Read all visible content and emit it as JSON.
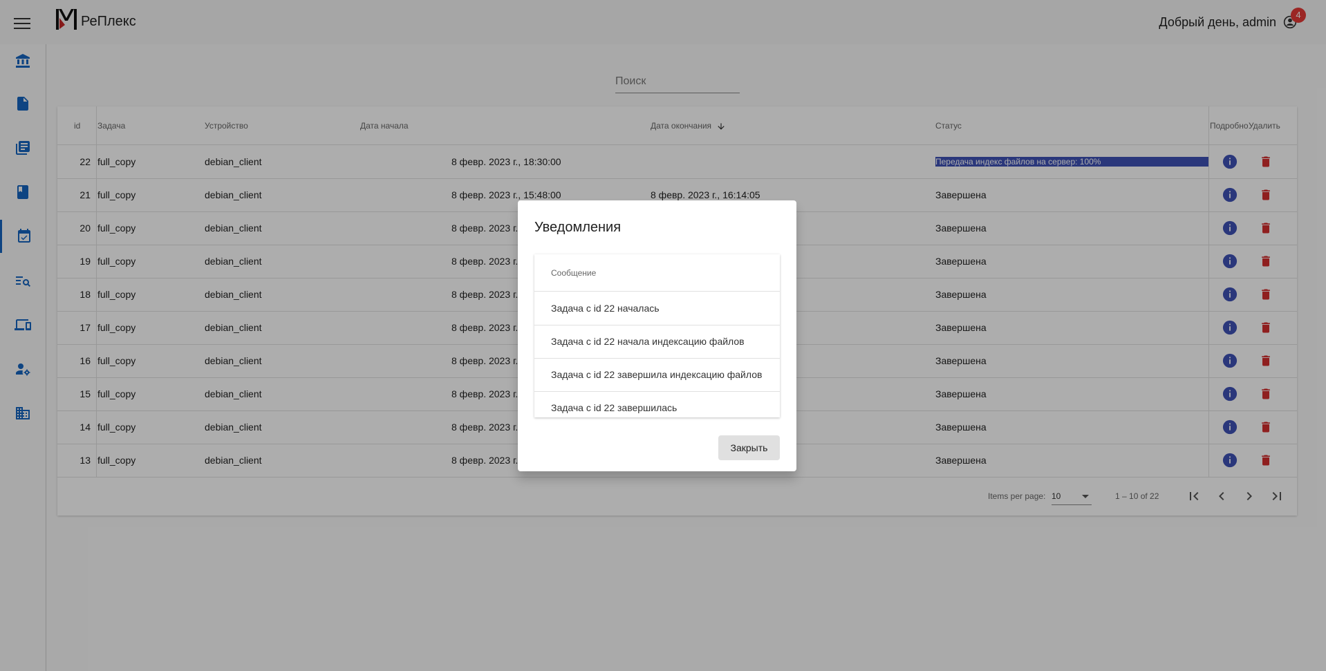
{
  "app": {
    "title": "РеПлекс",
    "greeting": "Добрый день, admin",
    "notification_count": "4"
  },
  "sidebar": {
    "items": [
      {
        "icon": "bank-icon"
      },
      {
        "icon": "document-icon"
      },
      {
        "icon": "library-icon"
      },
      {
        "icon": "book-icon"
      },
      {
        "icon": "calendar-check-icon",
        "active": true
      },
      {
        "icon": "search-list-icon"
      },
      {
        "icon": "devices-icon"
      },
      {
        "icon": "user-settings-icon"
      },
      {
        "icon": "building-icon"
      }
    ]
  },
  "search": {
    "placeholder": "Поиск"
  },
  "table": {
    "headers": {
      "id": "id",
      "task": "Задача",
      "device": "Устройство",
      "start": "Дата начала",
      "end": "Дата окончания",
      "status": "Статус",
      "details": "Подробно",
      "delete": "Удалить"
    },
    "rows": [
      {
        "id": "22",
        "task": "full_copy",
        "device": "debian_client",
        "start": "8 февр. 2023 г., 18:30:00",
        "end": "",
        "status": "Передача индекс файлов на сервер: 100%"
      },
      {
        "id": "21",
        "task": "full_copy",
        "device": "debian_client",
        "start": "8 февр. 2023 г., 15:48:00",
        "end": "8 февр. 2023 г., 16:14:05",
        "status": "Завершена"
      },
      {
        "id": "20",
        "task": "full_copy",
        "device": "debian_client",
        "start": "8 февр. 2023 г.",
        "end": "",
        "status": "Завершена"
      },
      {
        "id": "19",
        "task": "full_copy",
        "device": "debian_client",
        "start": "8 февр. 2023 г.",
        "end": "",
        "status": "Завершена"
      },
      {
        "id": "18",
        "task": "full_copy",
        "device": "debian_client",
        "start": "8 февр. 2023 г.",
        "end": "",
        "status": "Завершена"
      },
      {
        "id": "17",
        "task": "full_copy",
        "device": "debian_client",
        "start": "8 февр. 2023 г.",
        "end": "",
        "status": "Завершена"
      },
      {
        "id": "16",
        "task": "full_copy",
        "device": "debian_client",
        "start": "8 февр. 2023 г.",
        "end": "",
        "status": "Завершена"
      },
      {
        "id": "15",
        "task": "full_copy",
        "device": "debian_client",
        "start": "8 февр. 2023 г.",
        "end": "",
        "status": "Завершена"
      },
      {
        "id": "14",
        "task": "full_copy",
        "device": "debian_client",
        "start": "8 февр. 2023 г.",
        "end": "",
        "status": "Завершена"
      },
      {
        "id": "13",
        "task": "full_copy",
        "device": "debian_client",
        "start": "8 февр. 2023 г.",
        "end": "",
        "status": "Завершена"
      }
    ]
  },
  "paginator": {
    "items_label": "Items per page:",
    "page_size": "10",
    "range": "1 – 10 of 22"
  },
  "dialog": {
    "title": "Уведомления",
    "column": "Сообщение",
    "messages": [
      "Задача с id 22 началась",
      "Задача с id 22 начала индексацию файлов",
      "Задача с id 22 завершила индексацию файлов",
      "Задача с id 22 завершилась"
    ],
    "close_label": "Закрыть"
  },
  "colors": {
    "accent": "#1565c0",
    "info": "#3f51b5",
    "delete": "#d32f2f",
    "badge": "#e53935"
  }
}
